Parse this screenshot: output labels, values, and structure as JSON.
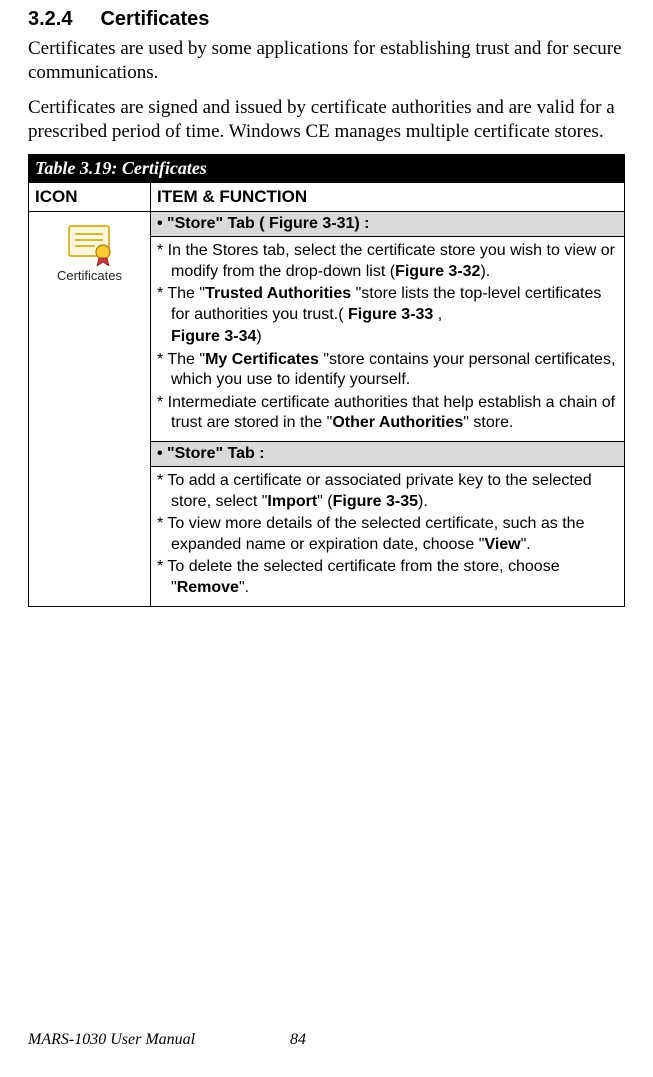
{
  "heading": {
    "number": "3.2.4",
    "title": "Certificates"
  },
  "para1": "Certificates are used by some applications for establishing trust and for secure communications.",
  "para2": "Certificates are signed and issued by certificate authorities and are valid for a prescribed period of time. Windows CE manages multiple certificate stores.",
  "table": {
    "title": "Table 3.19: Certificates",
    "head_icon": "ICON",
    "head_item": "ITEM & FUNCTION",
    "icon_label": "Certificates",
    "sub1": "•  \"Store\" Tab ( Figure 3-31) :",
    "r1a_pre": "*  In the Stores tab, select the certificate store you wish to view or modify from the drop-down list (",
    "r1a_b1": "Figure 3-32",
    "r1a_post": ").",
    "r1b_pre": "*  The \"",
    "r1b_b1": "Trusted Authorities ",
    "r1b_mid": "\"store lists the top-level certificates for authorities you trust.( ",
    "r1b_b2": "Figure 3-33 ",
    "r1b_sep": ", ",
    "r1b_b3": "Figure 3-34",
    "r1b_post": ")",
    "r1c_pre": "*  The \"",
    "r1c_b1": "My Certificates ",
    "r1c_post": "\"store contains your personal certificates, which you use to identify yourself.",
    "r1d_pre": "*  Intermediate certificate authorities that help establish a chain of trust are stored in the \"",
    "r1d_b1": "Other Authorities",
    "r1d_post": "\" store.",
    "sub2": "•  \"Store\" Tab :",
    "r2a_pre": "*  To add a certificate or associated private key to the selected store, select \"",
    "r2a_b1": "Import",
    "r2a_mid": "\" (",
    "r2a_b2": "Figure 3-35",
    "r2a_post": ").",
    "r2b_pre": "*  To view more details of the selected certificate, such as the expanded name or expiration date, choose \"",
    "r2b_b1": "View",
    "r2b_post": "\".",
    "r2c_pre": "*  To delete the selected certificate from the store, choose \"",
    "r2c_b1": "Remove",
    "r2c_post": "\"."
  },
  "footer": {
    "manual": "MARS-1030 User Manual",
    "page": "84"
  }
}
